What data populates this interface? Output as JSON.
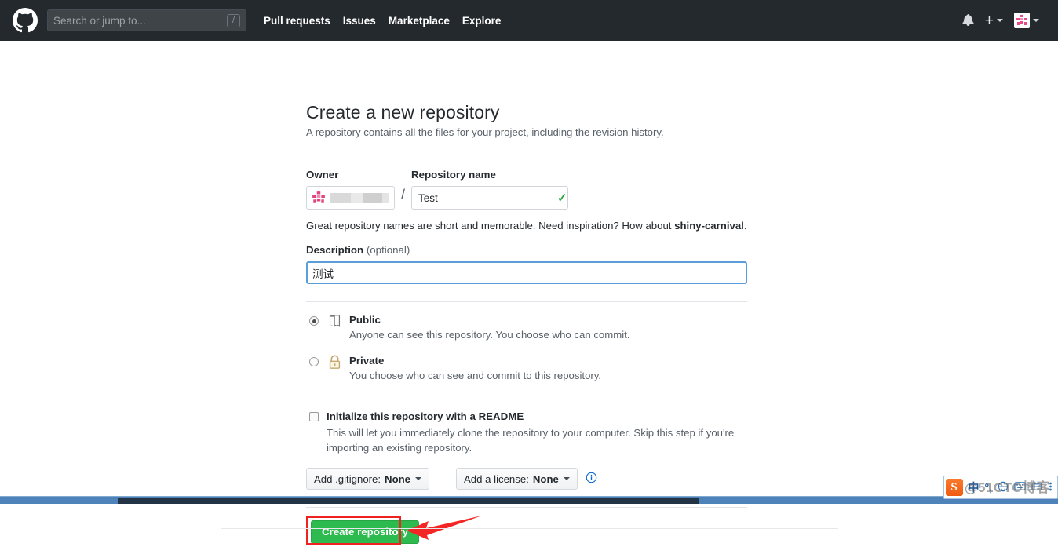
{
  "header": {
    "logo_icon": "github-mark-icon",
    "search": {
      "placeholder": "Search or jump to...",
      "value": "",
      "shortcut_badge": "/"
    },
    "nav": [
      {
        "label": "Pull requests"
      },
      {
        "label": "Issues"
      },
      {
        "label": "Marketplace"
      },
      {
        "label": "Explore"
      }
    ],
    "notifications_icon": "bell-icon",
    "create_new_icon": "plus-icon",
    "avatar_icon": "user-avatar-icon",
    "bg_color": "#24292e"
  },
  "main": {
    "title": "Create a new repository",
    "subtitle": "A repository contains all the files for your project, including the revision history.",
    "owner": {
      "label": "Owner",
      "avatar_icon": "owner-avatar-icon",
      "value": "",
      "redacted": true
    },
    "separator": "/",
    "repo_name": {
      "label": "Repository name",
      "value": "Test",
      "placeholder": "",
      "valid_icon": "check-icon"
    },
    "hint": {
      "text_before": "Great repository names are short and memorable. Need inspiration? How about ",
      "suggestion": "shiny-carnival",
      "text_after": "."
    },
    "description": {
      "label": "Description",
      "optional_label": " (optional)",
      "value": "测试",
      "placeholder": "",
      "focused": true,
      "focus_color": "#5b9dd9"
    },
    "visibility": [
      {
        "id": "public",
        "selected": true,
        "icon": "repo-book-icon",
        "title": "Public",
        "description": "Anyone can see this repository. You choose who can commit."
      },
      {
        "id": "private",
        "selected": false,
        "icon": "lock-icon",
        "title": "Private",
        "description": "You choose who can see and commit to this repository."
      }
    ],
    "readme": {
      "checked": false,
      "title": "Initialize this repository with a README",
      "description": "This will let you immediately clone the repository to your computer. Skip this step if you're importing an existing repository."
    },
    "selects": [
      {
        "prefix": "Add .gitignore: ",
        "value": "None",
        "caret_icon": "chevron-down-icon"
      },
      {
        "prefix": "Add a license: ",
        "value": "None",
        "caret_icon": "chevron-down-icon"
      }
    ],
    "info_icon": "info-circle-icon",
    "submit": {
      "label": "Create repository",
      "color": "#2dba4e"
    }
  },
  "annotations": {
    "highlight_color": "#ef2222",
    "box_target": "create-repository-button",
    "arrow_direction": "left"
  },
  "taskbar": {
    "ime": {
      "logo_text": "S",
      "mode_label": "中",
      "punct_label": "°,",
      "icons": [
        "globe-icon",
        "keyboard-icon",
        "toolbox-icon",
        "menu-icon"
      ]
    },
    "watermark": "@51CTO博客"
  }
}
